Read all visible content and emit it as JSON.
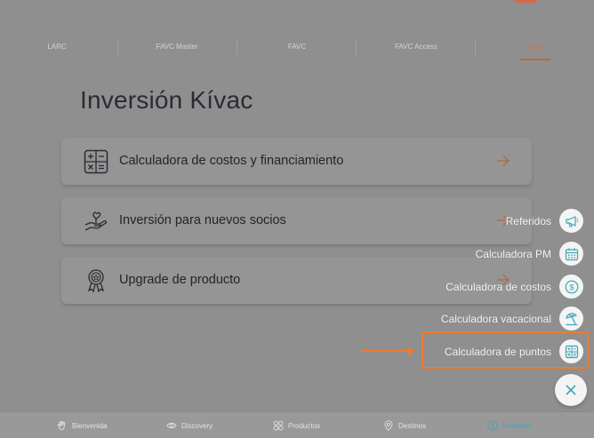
{
  "status_bar": {
    "left_text": "··· ···· ·",
    "right_text": "··· ·"
  },
  "tabs": [
    {
      "label": "LARC"
    },
    {
      "label": "FAVC Master"
    },
    {
      "label": "FAVC"
    },
    {
      "label": "FAVC Access"
    },
    {
      "label": "Kívac"
    }
  ],
  "active_tab": "Kívac",
  "page_title": "Inversión Kívac",
  "cards": [
    {
      "label": "Calculadora de costos y financiamiento",
      "icon": "calculator-icon"
    },
    {
      "label": "Inversión para nuevos socios",
      "icon": "plant-hand-icon"
    },
    {
      "label": "Upgrade de producto",
      "icon": "award-ribbon-icon"
    }
  ],
  "fab_menu": [
    {
      "label": "Referidos",
      "icon": "megaphone-icon"
    },
    {
      "label": "Calculadora PM",
      "icon": "calendar-icon"
    },
    {
      "label": "Calculadora de costos",
      "icon": "dollar-coin-icon"
    },
    {
      "label": "Calculadora vacacional",
      "icon": "beach-umbrella-icon"
    },
    {
      "label": "Calculadora de puntos",
      "icon": "calculator-grid-icon"
    }
  ],
  "highlighted_item": "Calculadora de puntos",
  "bottom_nav": [
    {
      "label": "Bienvenida",
      "icon": "hand-wave-icon"
    },
    {
      "label": "Discovery",
      "icon": "eye-icon"
    },
    {
      "label": "Productos",
      "icon": "grid-icon"
    },
    {
      "label": "Destinos",
      "icon": "location-pin-icon"
    },
    {
      "label": "Inversión",
      "icon": "dollar-circle-icon"
    }
  ],
  "active_nav": "Inversión",
  "colors": {
    "accent_teal": "#3aa6b5",
    "accent_orange": "#c9744c",
    "highlight_orange": "#f07a2e",
    "overlay_gray": "#8f8f8f"
  }
}
